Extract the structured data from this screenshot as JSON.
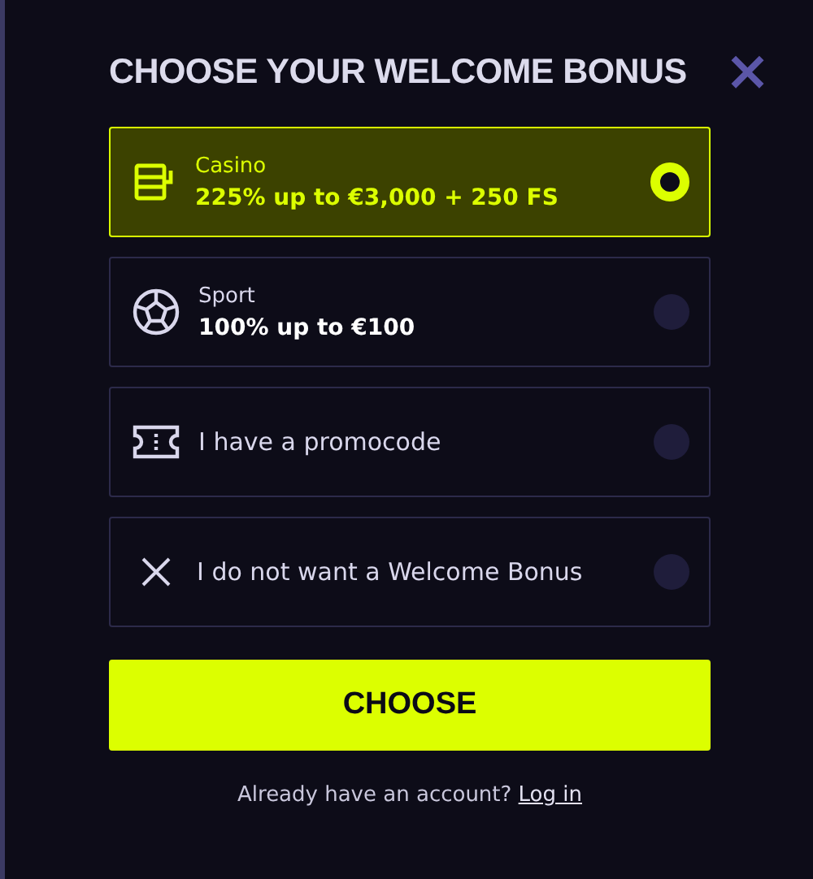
{
  "dialog": {
    "title": "CHOOSE YOUR WELCOME BONUS",
    "close": "×"
  },
  "options": [
    {
      "kind": "casino",
      "label": "Casino",
      "offer": "225% up to €3,000 + 250 FS",
      "selected": true
    },
    {
      "kind": "sport",
      "label": "Sport",
      "offer": "100% up to €100",
      "selected": false
    },
    {
      "kind": "promo",
      "label": "I have a promocode",
      "selected": false
    },
    {
      "kind": "none",
      "label": "I do not want a Welcome Bonus",
      "selected": false
    }
  ],
  "choose_button": "CHOOSE",
  "footer": {
    "text": "Already have an account?",
    "link": "Log in"
  }
}
